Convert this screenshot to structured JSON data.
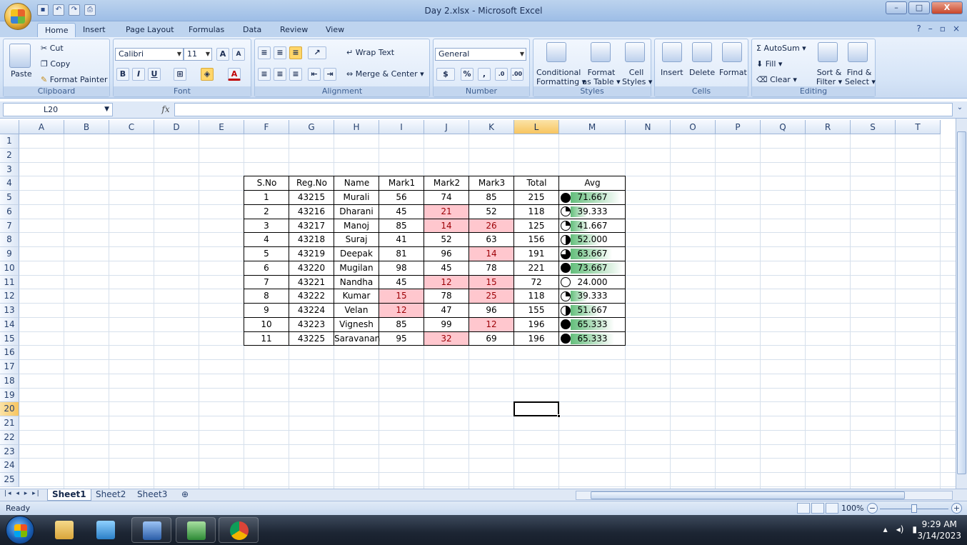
{
  "window": {
    "title": "Day 2.xlsx - Microsoft Excel",
    "minimize": "–",
    "maximize": "□",
    "close": "X"
  },
  "quick_access": [
    "save-icon",
    "undo-icon",
    "redo-icon",
    "print-preview-icon"
  ],
  "tabs": [
    "Home",
    "Insert",
    "Page Layout",
    "Formulas",
    "Data",
    "Review",
    "View"
  ],
  "active_tab": "Home",
  "ribbon": {
    "clipboard": {
      "paste": "Paste",
      "cut": "Cut",
      "copy": "Copy",
      "format_painter": "Format Painter",
      "label": "Clipboard"
    },
    "font": {
      "name": "Calibri",
      "size": "11",
      "bold": "B",
      "italic": "I",
      "underline": "U",
      "label": "Font"
    },
    "alignment": {
      "wrap_text": "Wrap Text",
      "merge_center": "Merge & Center",
      "label": "Alignment"
    },
    "number": {
      "format": "General",
      "currency": "$",
      "percent": "%",
      "comma": ",",
      "label": "Number"
    },
    "styles": {
      "conditional": "Conditional",
      "conditional2": "Formatting",
      "format_as": "Format",
      "format_as2": "as Table",
      "cell": "Cell",
      "cell2": "Styles",
      "label": "Styles"
    },
    "cells": {
      "insert": "Insert",
      "delete": "Delete",
      "format": "Format",
      "label": "Cells"
    },
    "editing": {
      "autosum": "AutoSum",
      "fill": "Fill",
      "clear": "Clear",
      "sort": "Sort &",
      "sort2": "Filter",
      "find": "Find &",
      "find2": "Select",
      "label": "Editing"
    }
  },
  "formula_bar": {
    "name_box": "L20",
    "fx": "fx",
    "formula": ""
  },
  "columns": [
    "A",
    "B",
    "C",
    "D",
    "E",
    "F",
    "G",
    "H",
    "I",
    "J",
    "K",
    "L",
    "M",
    "N",
    "O",
    "P",
    "Q",
    "R",
    "S",
    "T"
  ],
  "selected_column": "L",
  "rows": [
    "1",
    "2",
    "3",
    "4",
    "5",
    "6",
    "7",
    "8",
    "9",
    "10",
    "11",
    "12",
    "13",
    "14",
    "15",
    "16",
    "17",
    "18",
    "19",
    "20",
    "21",
    "22",
    "23",
    "24",
    "25"
  ],
  "selected_row": "20",
  "table": {
    "headers": [
      "S.No",
      "Reg.No",
      "Name",
      "Mark1",
      "Mark2",
      "Mark3",
      "Total",
      "Avg"
    ],
    "rows": [
      {
        "sno": "1",
        "reg": "43215",
        "name": "Murali",
        "m1": "56",
        "m2": "74",
        "m3": "85",
        "total": "215",
        "avg": "71.667",
        "avg_value": 71.667,
        "quarters": 4,
        "bad": []
      },
      {
        "sno": "2",
        "reg": "43216",
        "name": "Dharani",
        "m1": "45",
        "m2": "21",
        "m3": "52",
        "total": "118",
        "avg": "39.333",
        "avg_value": 39.333,
        "quarters": 1,
        "bad": [
          "m2"
        ]
      },
      {
        "sno": "3",
        "reg": "43217",
        "name": "Manoj",
        "m1": "85",
        "m2": "14",
        "m3": "26",
        "total": "125",
        "avg": "41.667",
        "avg_value": 41.667,
        "quarters": 1,
        "bad": [
          "m2",
          "m3"
        ]
      },
      {
        "sno": "4",
        "reg": "43218",
        "name": "Suraj",
        "m1": "41",
        "m2": "52",
        "m3": "63",
        "total": "156",
        "avg": "52.000",
        "avg_value": 52.0,
        "quarters": 2,
        "bad": []
      },
      {
        "sno": "5",
        "reg": "43219",
        "name": "Deepak",
        "m1": "81",
        "m2": "96",
        "m3": "14",
        "total": "191",
        "avg": "63.667",
        "avg_value": 63.667,
        "quarters": 3,
        "bad": [
          "m3"
        ]
      },
      {
        "sno": "6",
        "reg": "43220",
        "name": "Mugilan",
        "m1": "98",
        "m2": "45",
        "m3": "78",
        "total": "221",
        "avg": "73.667",
        "avg_value": 73.667,
        "quarters": 4,
        "bad": []
      },
      {
        "sno": "7",
        "reg": "43221",
        "name": "Nandha",
        "m1": "45",
        "m2": "12",
        "m3": "15",
        "total": "72",
        "avg": "24.000",
        "avg_value": 24.0,
        "quarters": 0,
        "bad": [
          "m2",
          "m3"
        ]
      },
      {
        "sno": "8",
        "reg": "43222",
        "name": "Kumar",
        "m1": "15",
        "m2": "78",
        "m3": "25",
        "total": "118",
        "avg": "39.333",
        "avg_value": 39.333,
        "quarters": 1,
        "bad": [
          "m1",
          "m3"
        ]
      },
      {
        "sno": "9",
        "reg": "43224",
        "name": "Velan",
        "m1": "12",
        "m2": "47",
        "m3": "96",
        "total": "155",
        "avg": "51.667",
        "avg_value": 51.667,
        "quarters": 2,
        "bad": [
          "m1"
        ]
      },
      {
        "sno": "10",
        "reg": "43223",
        "name": "Vignesh",
        "m1": "85",
        "m2": "99",
        "m3": "12",
        "total": "196",
        "avg": "65.333",
        "avg_value": 65.333,
        "quarters": 4,
        "bad": [
          "m3"
        ]
      },
      {
        "sno": "11",
        "reg": "43225",
        "name": "Saravanan",
        "m1": "95",
        "m2": "32",
        "m3": "69",
        "total": "196",
        "avg": "65.333",
        "avg_value": 65.333,
        "quarters": 4,
        "bad": [
          "m2"
        ]
      }
    ],
    "databar_min": 24.0,
    "databar_max": 73.667
  },
  "sheets": [
    "Sheet1",
    "Sheet2",
    "Sheet3"
  ],
  "active_sheet": "Sheet1",
  "status": {
    "ready": "Ready",
    "zoom": "100%"
  },
  "taskbar": {
    "apps": [
      "windows-explorer-icon",
      "file-manager-icon",
      "word-icon",
      "excel-icon",
      "chrome-icon"
    ],
    "time": "9:29 AM",
    "date": "3/14/2023"
  },
  "colors": {
    "bad_fill": "#ffc7ce",
    "bad_text": "#9c0006",
    "databar": "#63be7b",
    "selection_header": "#f7c560"
  }
}
